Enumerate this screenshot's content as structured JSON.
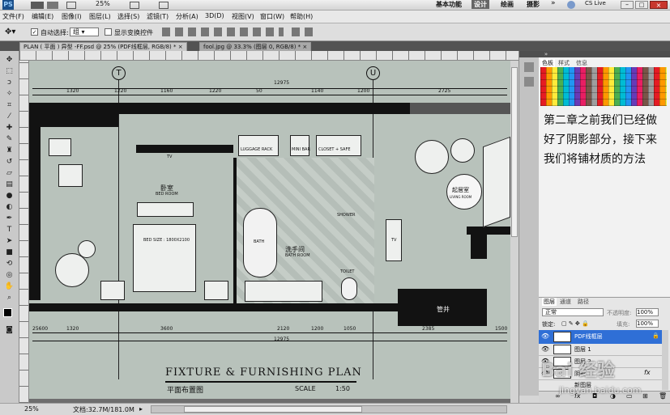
{
  "app": {
    "logo": "PS",
    "zoom": "25%",
    "workspaces": [
      "基本功能",
      "设计",
      "绘画",
      "摄影"
    ],
    "more": "»",
    "cslive": "CS Live"
  },
  "menu": [
    "文件(F)",
    "编辑(E)",
    "图像(I)",
    "图层(L)",
    "选择(S)",
    "滤镜(T)",
    "分析(A)",
    "3D(D)",
    "视图(V)",
    "窗口(W)",
    "帮助(H)"
  ],
  "options": {
    "auto_select_label": "自动选择:",
    "auto_select_value": "组",
    "show_transform_label": "显示变换控件"
  },
  "tabs": [
    {
      "label": "PLAN ( 平面 ) 异型 -FF.psd @ 25% (PDF线框层, RGB/8) *",
      "close": "×"
    },
    {
      "label": "fool.jpg @ 33.3% (图层 0, RGB/8) *",
      "close": "×"
    }
  ],
  "plan": {
    "grid_left": "T",
    "grid_right": "U",
    "dims_top": [
      "12975",
      "1320",
      "1220",
      "1160",
      "1220",
      "50",
      "1140",
      "1200",
      "2725"
    ],
    "dims_bottom": [
      "12975",
      "1320",
      "3600",
      "2120",
      "1200",
      "1050",
      "2385",
      "1500"
    ],
    "side_dims": [
      "25600",
      "25600"
    ],
    "rooms": {
      "bedroom": "卧室",
      "bedroom_en": "BED ROOM",
      "bath": "洗手间",
      "bath_en": "BATH ROOM",
      "living": "起居室",
      "living_en": "LIVING ROOM",
      "shaft": "管井",
      "tv": "TV",
      "bed_size": "BED SIZE : 1800X2100",
      "tub": "BATH",
      "shower": "SHOWER",
      "toilet": "TOILET",
      "minibar": "MINI BAR",
      "luggage": "LUGGAGE RACK",
      "closet": "CLOSET + SAFE"
    },
    "title": "FIXTURE  &  FURNISHING  PLAN",
    "subtitle": "平面布置图",
    "scale_label": "SCALE",
    "scale_value": "1:50"
  },
  "panel": {
    "tabs": [
      "色板",
      "样式",
      "信息"
    ],
    "note": "第二章之前我们已经做好了阴影部分，接下来我们将铺材质的方法",
    "layer_tabs": [
      "图层",
      "通道",
      "路径"
    ],
    "blend_mode": "正常",
    "opacity_label": "不透明度:",
    "opacity_value": "100%",
    "lock_label": "锁定:",
    "fill_label": "填充:",
    "fill_value": "100%",
    "layers": [
      {
        "name": "PDF线框层",
        "selected": true
      },
      {
        "name": "图层 1",
        "selected": false
      },
      {
        "name": "图层 2",
        "selected": false
      },
      {
        "name": "阴影",
        "selected": false
      },
      {
        "name": "新图层",
        "selected": false
      }
    ],
    "fx": "fx"
  },
  "status": {
    "zoom": "25%",
    "doc": "文档:32.7M/181.0M"
  },
  "watermark": "Bai 经验",
  "watermark_url": "jingyan.baidu.com"
}
